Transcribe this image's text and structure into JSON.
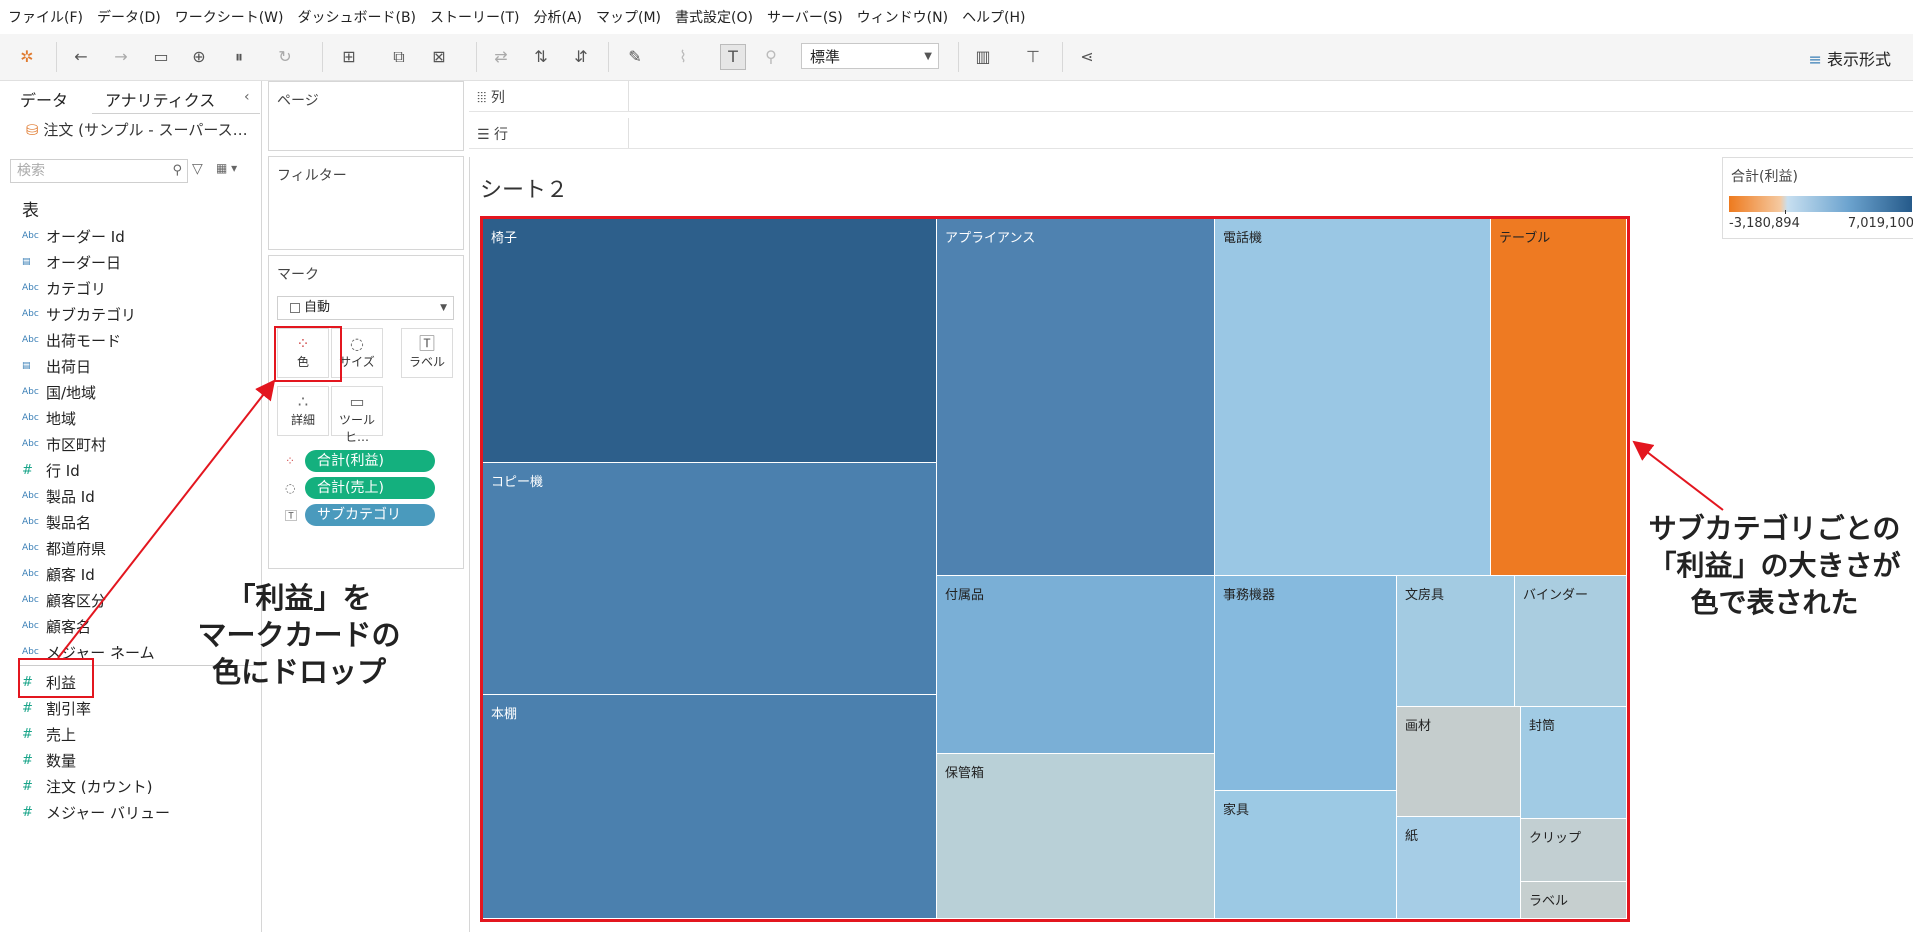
{
  "menu": [
    "ファイル(F)",
    "データ(D)",
    "ワークシート(W)",
    "ダッシュボード(B)",
    "ストーリー(T)",
    "分析(A)",
    "マップ(M)",
    "書式設定(O)",
    "サーバー(S)",
    "ウィンドウ(N)",
    "ヘルプ(H)"
  ],
  "toolbar": {
    "fit_value": "標準",
    "show_me_label": "表示形式"
  },
  "data_pane": {
    "tab_data": "データ",
    "tab_analytics": "アナリティクス",
    "datasource": "注文 (サンプル - スーパース…",
    "search_placeholder": "検索",
    "tables_header": "表",
    "fields": [
      {
        "name": "オーダー Id",
        "type": "Abc"
      },
      {
        "name": "オーダー日",
        "type": "date"
      },
      {
        "name": "カテゴリ",
        "type": "Abc"
      },
      {
        "name": "サブカテゴリ",
        "type": "Abc"
      },
      {
        "name": "出荷モード",
        "type": "Abc"
      },
      {
        "name": "出荷日",
        "type": "date"
      },
      {
        "name": "国/地域",
        "type": "Abc"
      },
      {
        "name": "地域",
        "type": "Abc"
      },
      {
        "name": "市区町村",
        "type": "Abc"
      },
      {
        "name": "行 Id",
        "type": "#"
      },
      {
        "name": "製品 Id",
        "type": "Abc"
      },
      {
        "name": "製品名",
        "type": "Abc"
      },
      {
        "name": "都道府県",
        "type": "Abc"
      },
      {
        "name": "顧客 Id",
        "type": "Abc"
      },
      {
        "name": "顧客区分",
        "type": "Abc"
      },
      {
        "name": "顧客名",
        "type": "Abc"
      },
      {
        "name": "メジャー ネーム",
        "type": "Abc"
      },
      {
        "name": "利益",
        "type": "#"
      },
      {
        "name": "割引率",
        "type": "#"
      },
      {
        "name": "売上",
        "type": "#"
      },
      {
        "name": "数量",
        "type": "#"
      },
      {
        "name": "注文 (カウント)",
        "type": "#"
      },
      {
        "name": "メジャー バリュー",
        "type": "#"
      }
    ]
  },
  "cards": {
    "pages": "ページ",
    "filters": "フィルター",
    "marks": "マーク",
    "mark_type": "自動",
    "buttons": {
      "color": "色",
      "size": "サイズ",
      "label": "ラベル",
      "detail": "詳細",
      "tooltip": "ツールヒ…"
    },
    "pills": [
      "合計(利益)",
      "合計(売上)",
      "サブカテゴリ"
    ]
  },
  "shelves": {
    "columns": "列",
    "rows": "行"
  },
  "sheet": {
    "title": "シート２"
  },
  "legend": {
    "title": "合計(利益)",
    "min": "-3,180,894",
    "max": "7,019,100"
  },
  "treemap": [
    {
      "label": "椅子",
      "color": "#2d5f8b",
      "text": "#fff"
    },
    {
      "label": "コピー機",
      "color": "#4b80ae",
      "text": "#fff"
    },
    {
      "label": "本棚",
      "color": "#4b80ae",
      "text": "#fff"
    },
    {
      "label": "アプライアンス",
      "color": "#4f82b0",
      "text": "#fff"
    },
    {
      "label": "付属品",
      "color": "#7aafd6",
      "text": "#222"
    },
    {
      "label": "保管箱",
      "color": "#b9d0d7",
      "text": "#222"
    },
    {
      "label": "電話機",
      "color": "#9ac7e4",
      "text": "#222"
    },
    {
      "label": "事務機器",
      "color": "#86bade",
      "text": "#222"
    },
    {
      "label": "家具",
      "color": "#9cc9e4",
      "text": "#222"
    },
    {
      "label": "テーブル",
      "color": "#ee7a22",
      "text": "#222"
    },
    {
      "label": "文房具",
      "color": "#a3cbe2",
      "text": "#222"
    },
    {
      "label": "バインダー",
      "color": "#aacde0",
      "text": "#222"
    },
    {
      "label": "画材",
      "color": "#c5cdcd",
      "text": "#222"
    },
    {
      "label": "封筒",
      "color": "#a1cbe4",
      "text": "#222"
    },
    {
      "label": "紙",
      "color": "#a6cde6",
      "text": "#222"
    },
    {
      "label": "クリップ",
      "color": "#c2cfd2",
      "text": "#222"
    },
    {
      "label": "ラベル",
      "color": "#c6cfcf",
      "text": "#222"
    }
  ],
  "annotations": {
    "left_lines": [
      "「利益」を",
      "マークカードの",
      "色にドロップ"
    ],
    "right_lines": [
      "サブカテゴリごとの",
      "「利益」の大きさが",
      "色で表された"
    ]
  }
}
